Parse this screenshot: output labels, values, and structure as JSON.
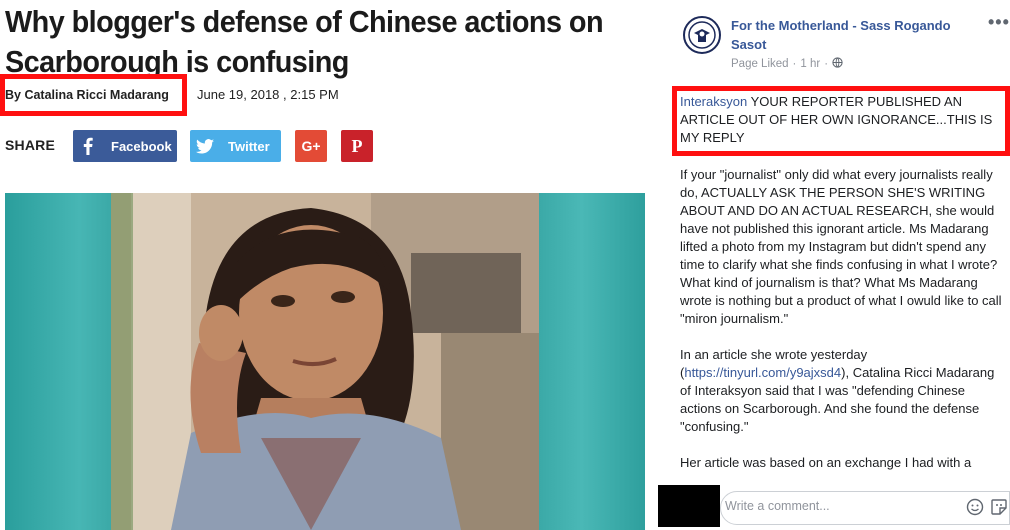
{
  "article": {
    "headline": "Why blogger's defense of Chinese actions on Scarborough is confusing",
    "byline": "By Catalina Ricci Madarang",
    "date": "June 19, 2018 , 2:15 PM",
    "share_label": "SHARE",
    "share_buttons": {
      "facebook": "Facebook",
      "twitter": "Twitter",
      "googleplus": "G+",
      "pinterest": "P"
    }
  },
  "facebook_post": {
    "page_name": "For the Motherland - Sass Rogando Sasot",
    "status": "Page Liked",
    "time": "1 hr",
    "more": "•••",
    "highlight_link": "Interaksyon",
    "highlight_text": " YOUR REPORTER PUBLISHED AN ARTICLE OUT OF HER OWN IGNORANCE...THIS IS MY REPLY",
    "paragraph1": "If your \"journalist\" only did what every journalists really do, ACTUALLY ASK THE PERSON SHE'S WRITING ABOUT AND DO AN ACTUAL RESEARCH, she would have not published this ignorant article. Ms Madarang lifted a photo from my Instagram but didn't spend any time to clarify what she finds confusing in what I wrote? What kind of journalism is that? What Ms Madarang wrote is nothing but a product of what I owuld like to call \"miron journalism.\"",
    "paragraph2_pre": "In an article she wrote yesterday (",
    "paragraph2_link": "https://tinyurl.com/y9ajxsd4",
    "paragraph2_post": "), Catalina Ricci Madarang of Interaksyon said that I was \"defending Chinese actions on Scarborough. And she found the defense \"confusing.\"",
    "paragraph3": "Her article was based on an exchange I had with a",
    "comment_placeholder": "Write a comment..."
  },
  "colors": {
    "highlight_border": "#ff1010",
    "facebook_blue": "#3b5b99",
    "twitter_blue": "#4aaee8",
    "googleplus_red": "#e34b36",
    "pinterest_red": "#c9222a",
    "fb_link": "#385898"
  }
}
